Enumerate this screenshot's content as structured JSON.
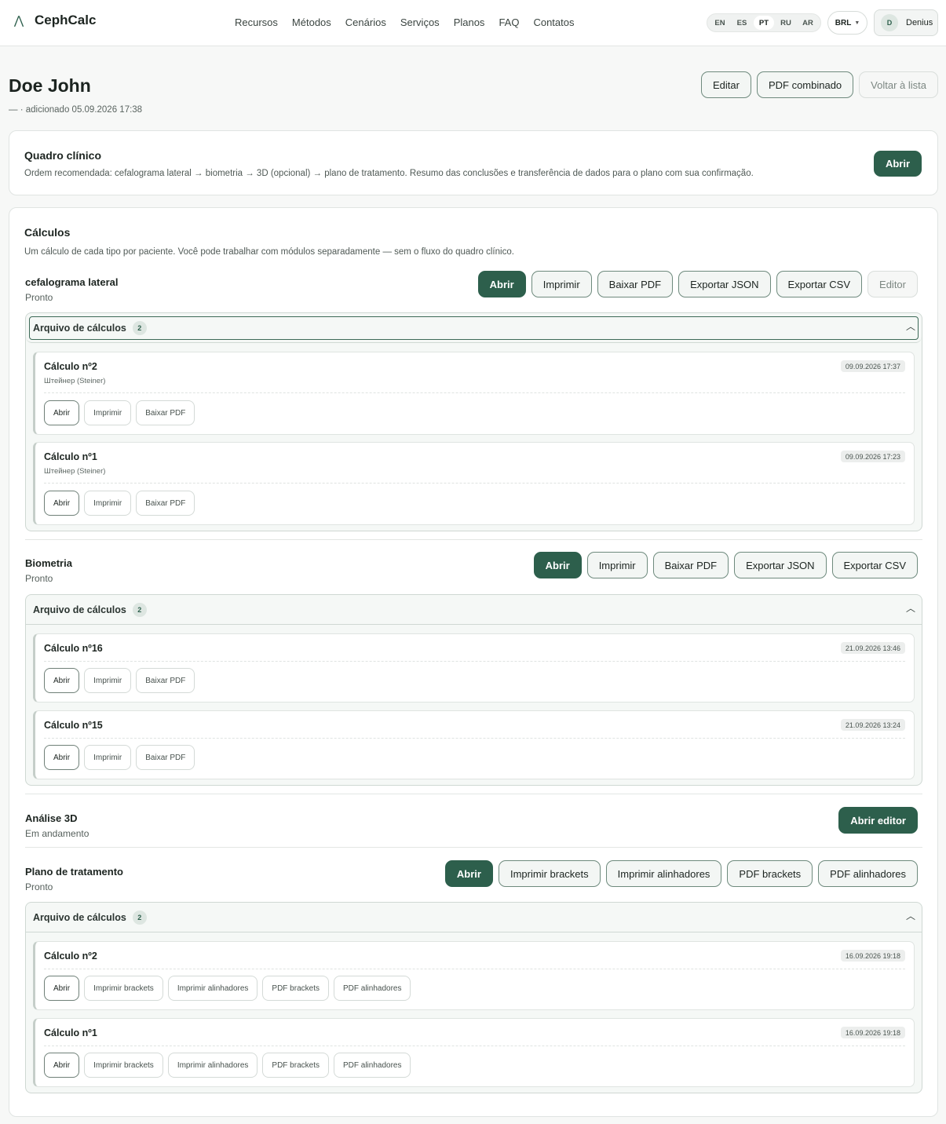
{
  "app": {
    "logo_text": "CephCalc",
    "nav": [
      "Recursos",
      "Métodos",
      "Cenários",
      "Serviços",
      "Planos",
      "FAQ",
      "Contatos"
    ],
    "languages": [
      "EN",
      "ES",
      "PT",
      "RU",
      "AR"
    ],
    "active_language": "PT",
    "currency": "BRL",
    "user_initial": "D",
    "user_name": "Denius"
  },
  "patient": {
    "name": "Doe John",
    "subtitle": "— · adicionado 05.09.2026 17:38",
    "actions": {
      "edit": "Editar",
      "combined_pdf": "PDF combinado",
      "back": "Voltar à lista"
    }
  },
  "clinical": {
    "title": "Quadro clínico",
    "description": "Ordem recomendada: cefalograma lateral → biometria → 3D (opcional) → plano de tratamento. Resumo das conclusões e transferência de dados para o plano com sua confirmação.",
    "open": "Abrir"
  },
  "calcs": {
    "title": "Cálculos",
    "description": "Um cálculo de cada tipo por paciente. Você pode trabalhar com módulos separadamente — sem o fluxo do quadro clínico.",
    "ceph": {
      "name": "cefalograma lateral",
      "status": "Pronto",
      "actions": [
        "Abrir",
        "Imprimir",
        "Baixar PDF",
        "Exportar JSON",
        "Exportar CSV",
        "Editor"
      ],
      "archive": {
        "title": "Arquivo de cálculos",
        "count": "2",
        "items": [
          {
            "title": "Cálculo nº2",
            "method": "Штейнер (Steiner)",
            "date": "09.09.2026 17:37",
            "actions": [
              "Abrir",
              "Imprimir",
              "Baixar PDF"
            ]
          },
          {
            "title": "Cálculo nº1",
            "method": "Штейнер (Steiner)",
            "date": "09.09.2026 17:23",
            "actions": [
              "Abrir",
              "Imprimir",
              "Baixar PDF"
            ]
          }
        ]
      }
    },
    "bio": {
      "name": "Biometria",
      "status": "Pronto",
      "actions": [
        "Abrir",
        "Imprimir",
        "Baixar PDF",
        "Exportar JSON",
        "Exportar CSV"
      ],
      "archive": {
        "title": "Arquivo de cálculos",
        "count": "2",
        "items": [
          {
            "title": "Cálculo nº16",
            "date": "21.09.2026 13:46",
            "actions": [
              "Abrir",
              "Imprimir",
              "Baixar PDF"
            ]
          },
          {
            "title": "Cálculo nº15",
            "date": "21.09.2026 13:24",
            "actions": [
              "Abrir",
              "Imprimir",
              "Baixar PDF"
            ]
          }
        ]
      }
    },
    "analysis3d": {
      "name": "Análise 3D",
      "status": "Em andamento",
      "open_editor": "Abrir editor"
    },
    "plan": {
      "name": "Plano de tratamento",
      "status": "Pronto",
      "actions": [
        "Abrir",
        "Imprimir brackets",
        "Imprimir alinhadores",
        "PDF brackets",
        "PDF alinhadores"
      ],
      "archive": {
        "title": "Arquivo de cálculos",
        "count": "2",
        "items": [
          {
            "title": "Cálculo nº2",
            "date": "16.09.2026 19:18",
            "actions": [
              "Abrir",
              "Imprimir brackets",
              "Imprimir alinhadores",
              "PDF brackets",
              "PDF alinhadores"
            ]
          },
          {
            "title": "Cálculo nº1",
            "date": "16.09.2026 19:18",
            "actions": [
              "Abrir",
              "Imprimir brackets",
              "Imprimir alinhadores",
              "PDF brackets",
              "PDF alinhadores"
            ]
          }
        ]
      }
    }
  },
  "colors": {
    "accent": "#2d5f4c",
    "background": "#f7f8f7"
  }
}
